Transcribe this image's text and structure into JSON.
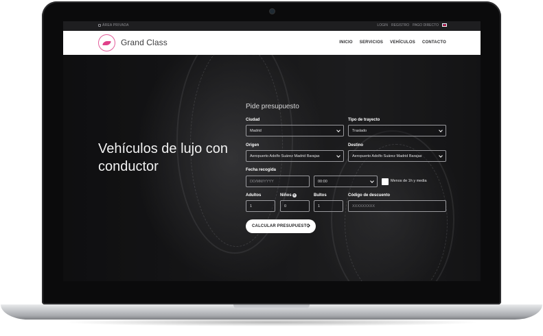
{
  "topbar": {
    "private_area": "ÁREA PRIVADA",
    "links": [
      "LOGIN",
      "REGISTRO",
      "PAGO DIRECTO"
    ],
    "flag_icon": "uk-flag-icon"
  },
  "navbar": {
    "brand": "Grand Class",
    "logo_icon": "grand-class-logo-icon",
    "menu": [
      "INICIO",
      "SERVICIOS",
      "VEHÍCULOS",
      "CONTACTO"
    ]
  },
  "hero": {
    "headline": "Vehículos de lujo con conductor"
  },
  "form": {
    "title": "Pide presupuesto",
    "city_label": "Ciudad",
    "city_value": "Madrid",
    "trip_type_label": "Tipo de trayecto",
    "trip_type_value": "Traslado",
    "origin_label": "Origen",
    "origin_value": "Aeropuerto Adolfo Suárez Madrid Barajas",
    "destination_label": "Destino",
    "destination_value": "Aeropuerto Adolfo Suárez Madrid Barajas",
    "pickup_date_label": "Fecha recogida",
    "date_placeholder": "DD/MM/YYYY",
    "time_value": "00:00",
    "short_trip_label": "Menos de 1h y media",
    "adults_label": "Adultos",
    "adults_value": "1",
    "children_label": "Niños",
    "children_value": "0",
    "bags_label": "Bultos",
    "bags_value": "1",
    "discount_label": "Código de descuento",
    "discount_placeholder": "XXXXXXXXX",
    "submit_label": "CALCULAR PRESUPUESTO"
  },
  "colors": {
    "brand_pink": "#e0418a",
    "nav_bg": "#ffffff",
    "hero_bg": "#1c1c1e"
  }
}
